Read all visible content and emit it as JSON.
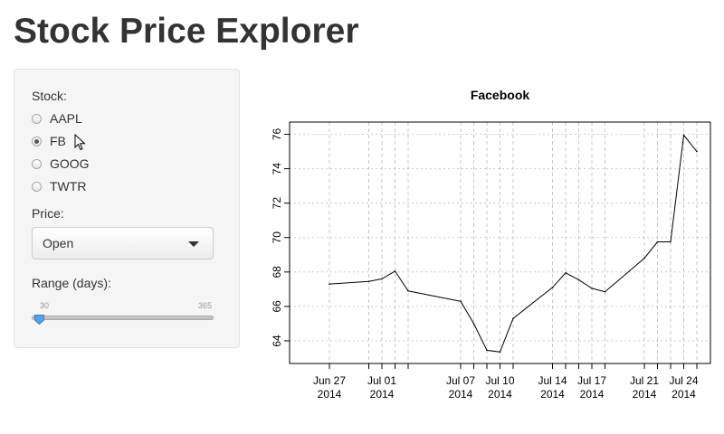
{
  "app": {
    "title": "Stock Price Explorer"
  },
  "sidebar": {
    "stock_label": "Stock:",
    "stocks": [
      {
        "label": "AAPL",
        "selected": false
      },
      {
        "label": "FB",
        "selected": true
      },
      {
        "label": "GOOG",
        "selected": false
      },
      {
        "label": "TWTR",
        "selected": false
      }
    ],
    "price_label": "Price:",
    "price_select": {
      "value": "Open"
    },
    "range_label": "Range (days):",
    "range_slider": {
      "min": "30",
      "max": "365",
      "value": 30
    }
  },
  "colors": {
    "handle": "#5aa0e6",
    "panel": "#f5f5f5",
    "line": "#000000"
  },
  "chart_data": {
    "type": "line",
    "title": "Facebook",
    "xlabel": "",
    "ylabel": "",
    "ylim": [
      63,
      76.5
    ],
    "y_ticks": [
      64,
      66,
      68,
      70,
      72,
      74,
      76
    ],
    "grid": true,
    "x_ticks": [
      {
        "date": "2014-06-27",
        "label": [
          "Jun 27",
          "2014"
        ]
      },
      {
        "date": "2014-06-30",
        "label": []
      },
      {
        "date": "2014-07-01",
        "label": [
          "Jul 01",
          "2014"
        ]
      },
      {
        "date": "2014-07-02",
        "label": []
      },
      {
        "date": "2014-07-03",
        "label": []
      },
      {
        "date": "2014-07-07",
        "label": [
          "Jul 07",
          "2014"
        ]
      },
      {
        "date": "2014-07-08",
        "label": []
      },
      {
        "date": "2014-07-09",
        "label": []
      },
      {
        "date": "2014-07-10",
        "label": [
          "Jul 10",
          "2014"
        ]
      },
      {
        "date": "2014-07-11",
        "label": []
      },
      {
        "date": "2014-07-14",
        "label": [
          "Jul 14",
          "2014"
        ]
      },
      {
        "date": "2014-07-15",
        "label": []
      },
      {
        "date": "2014-07-16",
        "label": []
      },
      {
        "date": "2014-07-17",
        "label": [
          "Jul 17",
          "2014"
        ]
      },
      {
        "date": "2014-07-18",
        "label": []
      },
      {
        "date": "2014-07-21",
        "label": [
          "Jul 21",
          "2014"
        ]
      },
      {
        "date": "2014-07-22",
        "label": []
      },
      {
        "date": "2014-07-23",
        "label": []
      },
      {
        "date": "2014-07-24",
        "label": [
          "Jul 24",
          "2014"
        ]
      },
      {
        "date": "2014-07-25",
        "label": []
      }
    ],
    "series": [
      {
        "x": [
          "2014-06-27",
          "2014-06-30",
          "2014-07-01",
          "2014-07-02",
          "2014-07-03",
          "2014-07-07",
          "2014-07-08",
          "2014-07-09",
          "2014-07-10",
          "2014-07-11",
          "2014-07-14",
          "2014-07-15",
          "2014-07-16",
          "2014-07-17",
          "2014-07-18",
          "2014-07-21",
          "2014-07-22",
          "2014-07-23",
          "2014-07-24",
          "2014-07-25"
        ],
        "y": [
          67.3,
          67.45,
          67.6,
          68.05,
          66.9,
          66.3,
          65.0,
          63.45,
          63.35,
          65.3,
          67.1,
          67.95,
          67.55,
          67.05,
          66.85,
          68.8,
          69.75,
          69.75,
          75.95,
          75.0
        ]
      }
    ]
  }
}
